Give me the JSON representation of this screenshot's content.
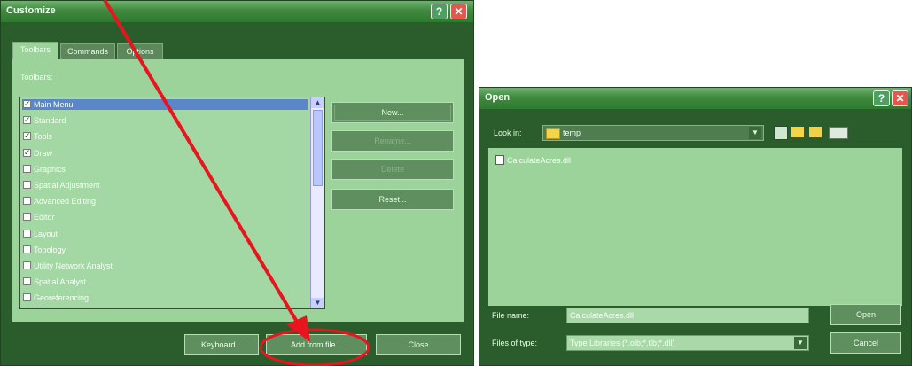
{
  "customize": {
    "title": "Customize",
    "tabs": [
      "Toolbars",
      "Commands",
      "Options"
    ],
    "toolbars_label": "Toolbars:",
    "items": [
      {
        "label": "Main Menu",
        "checked": true,
        "selected": true
      },
      {
        "label": "Standard",
        "checked": true,
        "selected": false
      },
      {
        "label": "Tools",
        "checked": true,
        "selected": false
      },
      {
        "label": "Draw",
        "checked": true,
        "selected": false
      },
      {
        "label": "Graphics",
        "checked": false,
        "selected": false
      },
      {
        "label": "Spatial Adjustment",
        "checked": false,
        "selected": false
      },
      {
        "label": "Advanced Editing",
        "checked": false,
        "selected": false
      },
      {
        "label": "Editor",
        "checked": false,
        "selected": false
      },
      {
        "label": "Layout",
        "checked": false,
        "selected": false
      },
      {
        "label": "Topology",
        "checked": false,
        "selected": false
      },
      {
        "label": "Utility Network Analyst",
        "checked": false,
        "selected": false
      },
      {
        "label": "Spatial Analyst",
        "checked": false,
        "selected": false
      },
      {
        "label": "Georeferencing",
        "checked": false,
        "selected": false
      }
    ],
    "buttons": {
      "new": "New...",
      "rename": "Rename...",
      "delete": "Delete",
      "reset": "Reset..."
    },
    "footer": {
      "keyboard": "Keyboard...",
      "add_from_file": "Add from file...",
      "close": "Close"
    }
  },
  "open": {
    "title": "Open",
    "look_in_label": "Look in:",
    "look_in_value": "temp",
    "files": [
      "CalculateAcres.dll"
    ],
    "file_name_label": "File name:",
    "file_name_value": "CalculateAcres.dll",
    "files_of_type_label": "Files of type:",
    "files_of_type_value": "Type Libraries (*.olb;*.tlb;*.dll)",
    "open_button": "Open",
    "cancel_button": "Cancel"
  },
  "colors": {
    "window": "#2b5c2b",
    "panel": "#9bd39b",
    "annotation": "#e8141e",
    "close_button": "#e6564a"
  }
}
